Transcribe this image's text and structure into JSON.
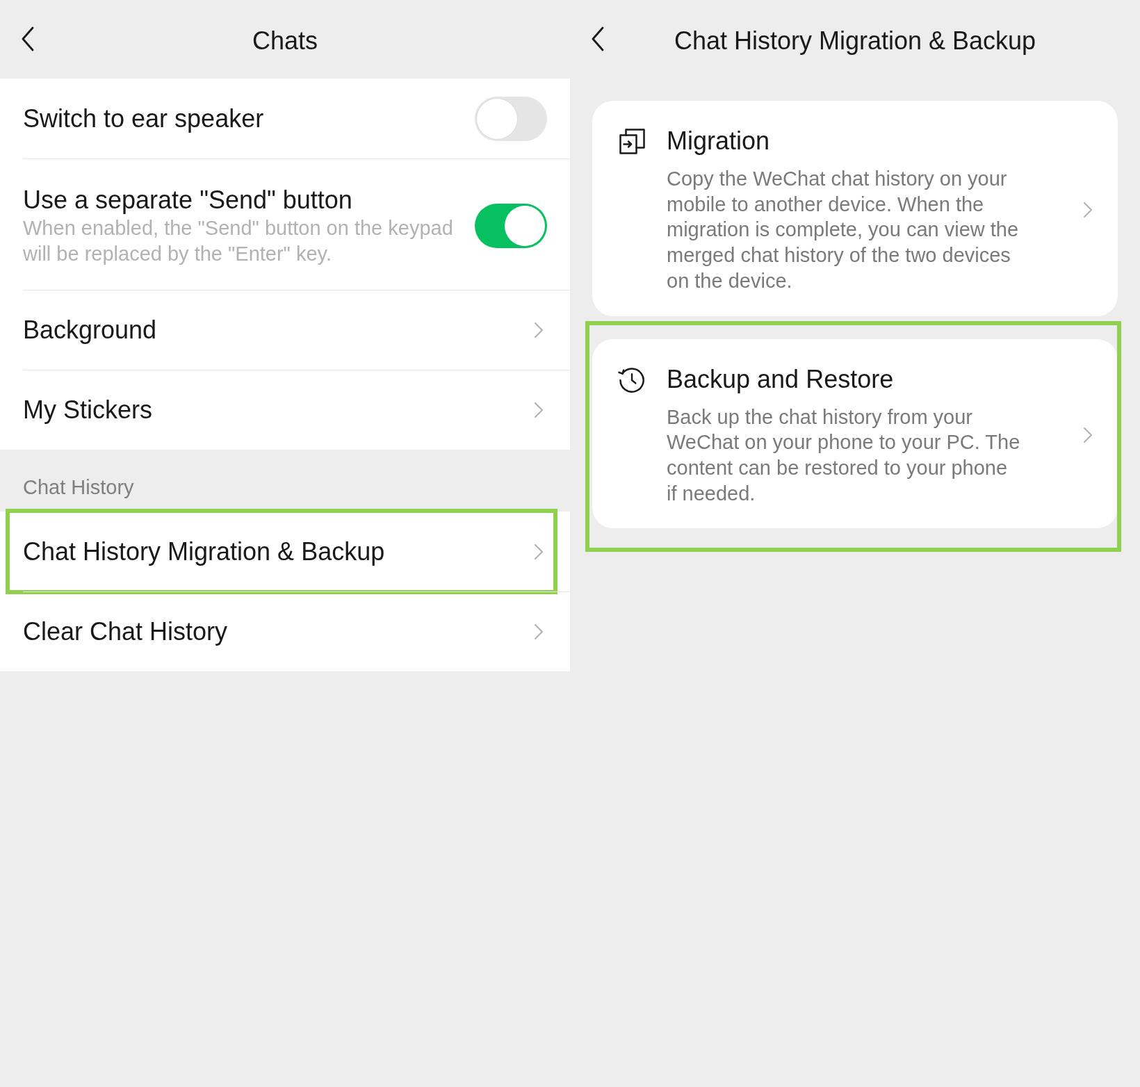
{
  "chats_screen": {
    "title": "Chats",
    "groups": [
      {
        "items": [
          {
            "kind": "toggle",
            "label": "Switch to ear speaker",
            "on": false,
            "highlighted": false
          },
          {
            "kind": "toggle",
            "label": "Use a separate \"Send\" button",
            "description": "When enabled, the \"Send\" button on the keypad will be replaced by the \"Enter\" key.",
            "on": true,
            "highlighted": false
          },
          {
            "kind": "link",
            "label": "Background",
            "highlighted": false
          },
          {
            "kind": "link",
            "label": "My Stickers",
            "highlighted": false
          }
        ]
      },
      {
        "section_title": "Chat History",
        "items": [
          {
            "kind": "link",
            "label": "Chat History Migration & Backup",
            "highlighted": true
          },
          {
            "kind": "link",
            "label": "Clear Chat History",
            "highlighted": false
          }
        ]
      }
    ]
  },
  "migration_screen": {
    "title": "Chat History Migration & Backup",
    "cards": [
      {
        "kind": "migration",
        "title": "Migration",
        "description": "Copy the WeChat chat history on your mobile to another device. When the migration is complete, you can view the merged chat history of the two devices on the device.",
        "highlighted": false
      },
      {
        "kind": "backup",
        "title": "Backup and Restore",
        "description": "Back up the chat history from your WeChat on your phone to your PC. The content can be restored to your phone if needed.",
        "highlighted": true
      }
    ]
  }
}
